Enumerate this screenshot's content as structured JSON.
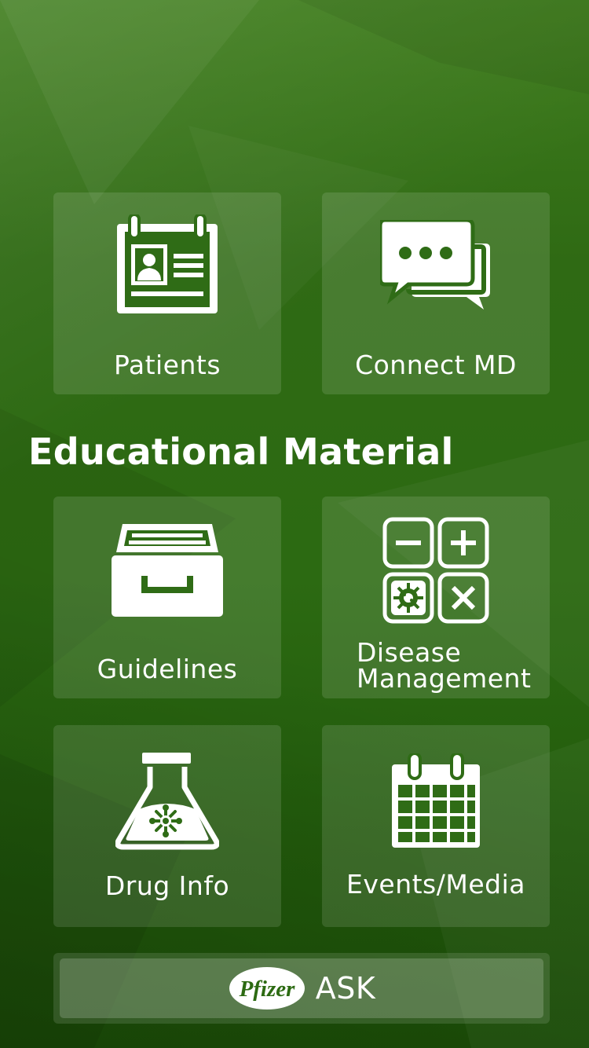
{
  "colors": {
    "background": "#2c6a12",
    "tile": "rgba(255,255,255,0.12)",
    "text": "#ffffff",
    "pfizer_logo_text": "#2c6a12"
  },
  "tiles_top": [
    {
      "label": "Patients",
      "icon": "id-card-clipboard-icon"
    },
    {
      "label": "Connect MD",
      "icon": "chat-bubbles-icon"
    }
  ],
  "section": {
    "title": "Educational Material"
  },
  "tiles_edu": [
    {
      "label": "Guidelines",
      "icon": "file-drawer-icon"
    },
    {
      "label_line1": "Disease",
      "label_line2": "Management",
      "icon": "calculator-grid-icon"
    },
    {
      "label": "Drug Info",
      "icon": "lab-flask-icon"
    },
    {
      "label": "Events/Media",
      "icon": "calendar-icon"
    }
  ],
  "ask_button": {
    "logo": "Pfizer",
    "label": "ASK"
  }
}
